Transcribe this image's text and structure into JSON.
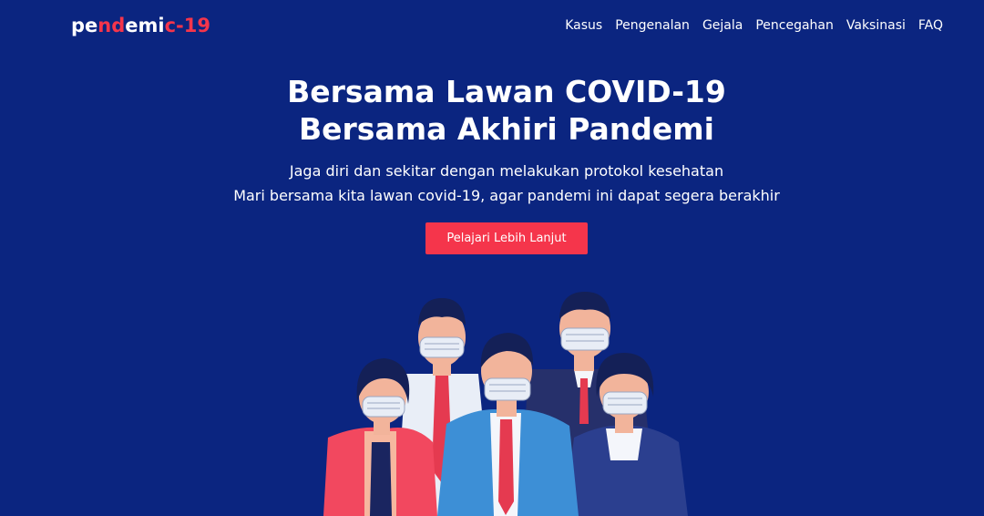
{
  "brand": {
    "parts": [
      {
        "text": "pe",
        "color": "#ffffff"
      },
      {
        "text": "nd",
        "color": "#f5354b"
      },
      {
        "text": "emi",
        "color": "#ffffff"
      },
      {
        "text": "c-19",
        "color": "#f5354b"
      }
    ]
  },
  "nav": {
    "items": [
      "Kasus",
      "Pengenalan",
      "Gejala",
      "Pencegahan",
      "Vaksinasi",
      "FAQ"
    ]
  },
  "hero": {
    "title_line1": "Bersama Lawan COVID-19",
    "title_line2": "Bersama Akhiri Pandemi",
    "subtitle_line1": "Jaga diri dan sekitar dengan melakukan protokol kesehatan",
    "subtitle_line2": "Mari bersama kita lawan covid-19, agar pandemi ini dapat segera berakhir",
    "cta_label": "Pelajari Lebih Lanjut"
  },
  "illustration": {
    "icon": "masked-people-group-illustration"
  },
  "colors": {
    "background": "#0b2580",
    "accent": "#f5354b",
    "text": "#ffffff"
  }
}
